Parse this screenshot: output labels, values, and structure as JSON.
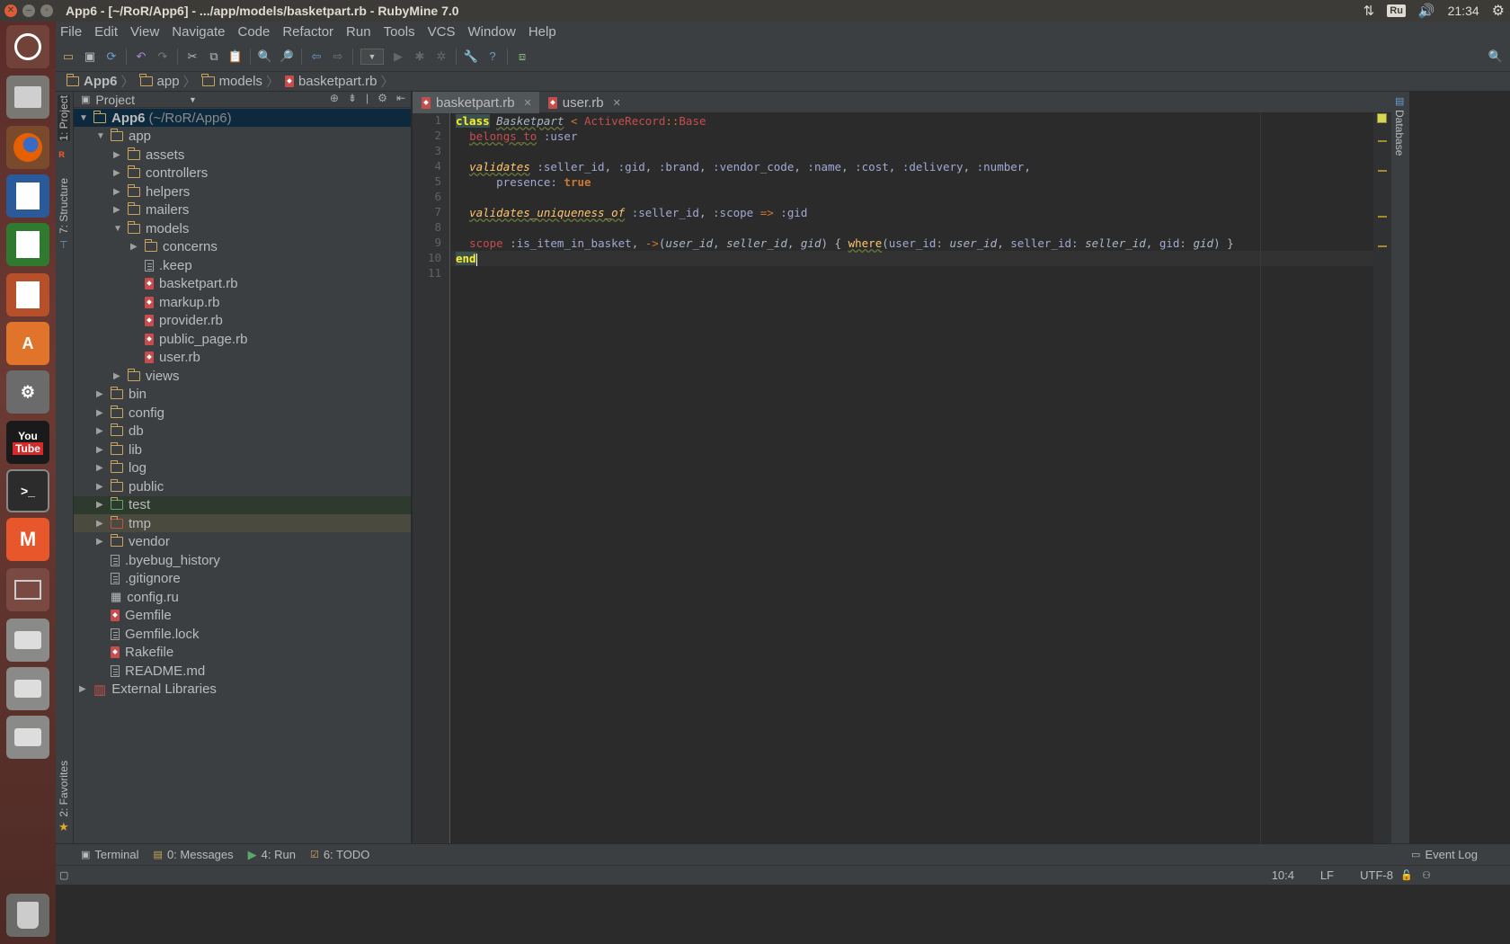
{
  "window": {
    "title": "App6 - [~/RoR/App6] - .../app/models/basketpart.rb - RubyMine 7.0",
    "keyboard_layout": "Ru",
    "clock": "21:34"
  },
  "menu": [
    "File",
    "Edit",
    "View",
    "Navigate",
    "Code",
    "Refactor",
    "Run",
    "Tools",
    "VCS",
    "Window",
    "Help"
  ],
  "breadcrumb": [
    "App6",
    "app",
    "models",
    "basketpart.rb"
  ],
  "left_tabs": {
    "project": "1: Project",
    "structure": "7: Structure",
    "favorites": "2: Favorites"
  },
  "right_tabs": {
    "database": "Database"
  },
  "project_panel": {
    "header": "Project",
    "tree": [
      {
        "label": "App6",
        "hint": "(~/RoR/App6)",
        "depth": 0,
        "type": "folder",
        "expanded": true,
        "bold": true
      },
      {
        "label": "app",
        "depth": 1,
        "type": "folder",
        "expanded": true
      },
      {
        "label": "assets",
        "depth": 2,
        "type": "folder",
        "expanded": false
      },
      {
        "label": "controllers",
        "depth": 2,
        "type": "folder",
        "expanded": false
      },
      {
        "label": "helpers",
        "depth": 2,
        "type": "folder",
        "expanded": false
      },
      {
        "label": "mailers",
        "depth": 2,
        "type": "folder",
        "expanded": false
      },
      {
        "label": "models",
        "depth": 2,
        "type": "folder",
        "expanded": true
      },
      {
        "label": "concerns",
        "depth": 3,
        "type": "folder",
        "expanded": false
      },
      {
        "label": ".keep",
        "depth": 3,
        "type": "file"
      },
      {
        "label": "basketpart.rb",
        "depth": 3,
        "type": "ruby"
      },
      {
        "label": "markup.rb",
        "depth": 3,
        "type": "ruby"
      },
      {
        "label": "provider.rb",
        "depth": 3,
        "type": "ruby"
      },
      {
        "label": "public_page.rb",
        "depth": 3,
        "type": "ruby"
      },
      {
        "label": "user.rb",
        "depth": 3,
        "type": "ruby"
      },
      {
        "label": "views",
        "depth": 2,
        "type": "folder",
        "expanded": false
      },
      {
        "label": "bin",
        "depth": 1,
        "type": "folder",
        "expanded": false
      },
      {
        "label": "config",
        "depth": 1,
        "type": "folder",
        "expanded": false
      },
      {
        "label": "db",
        "depth": 1,
        "type": "folder",
        "expanded": false
      },
      {
        "label": "lib",
        "depth": 1,
        "type": "folder",
        "expanded": false
      },
      {
        "label": "log",
        "depth": 1,
        "type": "folder",
        "expanded": false
      },
      {
        "label": "public",
        "depth": 1,
        "type": "folder",
        "expanded": false
      },
      {
        "label": "test",
        "depth": 1,
        "type": "folder-green",
        "expanded": false
      },
      {
        "label": "tmp",
        "depth": 1,
        "type": "folder-red",
        "expanded": false
      },
      {
        "label": "vendor",
        "depth": 1,
        "type": "folder",
        "expanded": false
      },
      {
        "label": ".byebug_history",
        "depth": 1,
        "type": "file"
      },
      {
        "label": ".gitignore",
        "depth": 1,
        "type": "file"
      },
      {
        "label": "config.ru",
        "depth": 1,
        "type": "grid"
      },
      {
        "label": "Gemfile",
        "depth": 1,
        "type": "ruby"
      },
      {
        "label": "Gemfile.lock",
        "depth": 1,
        "type": "file"
      },
      {
        "label": "Rakefile",
        "depth": 1,
        "type": "ruby"
      },
      {
        "label": "README.md",
        "depth": 1,
        "type": "file"
      },
      {
        "label": "External Libraries",
        "depth": 0,
        "type": "library",
        "expanded": false
      }
    ]
  },
  "editor": {
    "tabs": [
      {
        "label": "basketpart.rb",
        "active": true
      },
      {
        "label": "user.rb",
        "active": false
      }
    ],
    "line_numbers": [
      "1",
      "2",
      "3",
      "4",
      "5",
      "6",
      "7",
      "8",
      "9",
      "10",
      "11"
    ]
  },
  "bottom_tabs": [
    {
      "label": "Terminal"
    },
    {
      "label": "0: Messages"
    },
    {
      "label": "4: Run"
    },
    {
      "label": "6: TODO"
    }
  ],
  "event_log": "Event Log",
  "status": {
    "position": "10:4",
    "line_sep": "LF",
    "encoding": "UTF-8"
  },
  "colors": {
    "accent_selected": "#0d293e",
    "keyword": "#cc7832",
    "method": "#ffc66d",
    "symbol": "#a0a9d4"
  }
}
